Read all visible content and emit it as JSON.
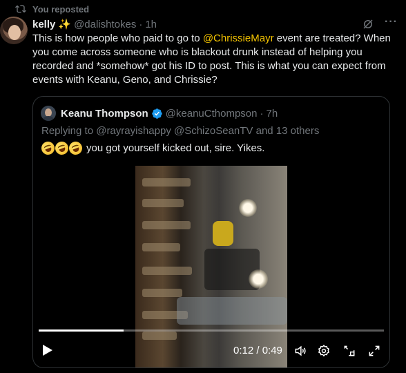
{
  "repost": {
    "label": "You reposted"
  },
  "post": {
    "author_name": "kelly",
    "author_emoji": "✨",
    "author_handle": "@dalishtokes",
    "time": "1h",
    "text_before": "This is how people who paid to go to ",
    "mention": "@ChrissieMayr",
    "text_after": " event are treated? When you come across someone who is blackout drunk instead of helping you recorded and *somehow* got his ID to post. This is what you can expect from events with Keanu, Geno, and Chrissie?",
    "more_label": "···"
  },
  "quote": {
    "author_name": "Keanu Thompson",
    "author_handle": "@keanuCthompson",
    "time": "7h",
    "replying_to": "Replying to @rayrayishappy @SchizoSeanTV and 13 others",
    "text": "you got yourself kicked out, sire. Yikes."
  },
  "video": {
    "current_time": "0:12",
    "duration": "0:49",
    "timecode": "0:12 / 0:49",
    "progress": 0.245
  },
  "icons": [
    "repost-icon",
    "grok-icon",
    "more-icon",
    "verified-icon",
    "play-icon",
    "volume-icon",
    "settings-icon",
    "pip-icon",
    "fullscreen-icon"
  ],
  "colors": {
    "accent_mention": "#f5c400",
    "verified": "#1d9bf0",
    "muted": "#71767b",
    "text": "#e7e9ea",
    "border": "#2f3336"
  }
}
